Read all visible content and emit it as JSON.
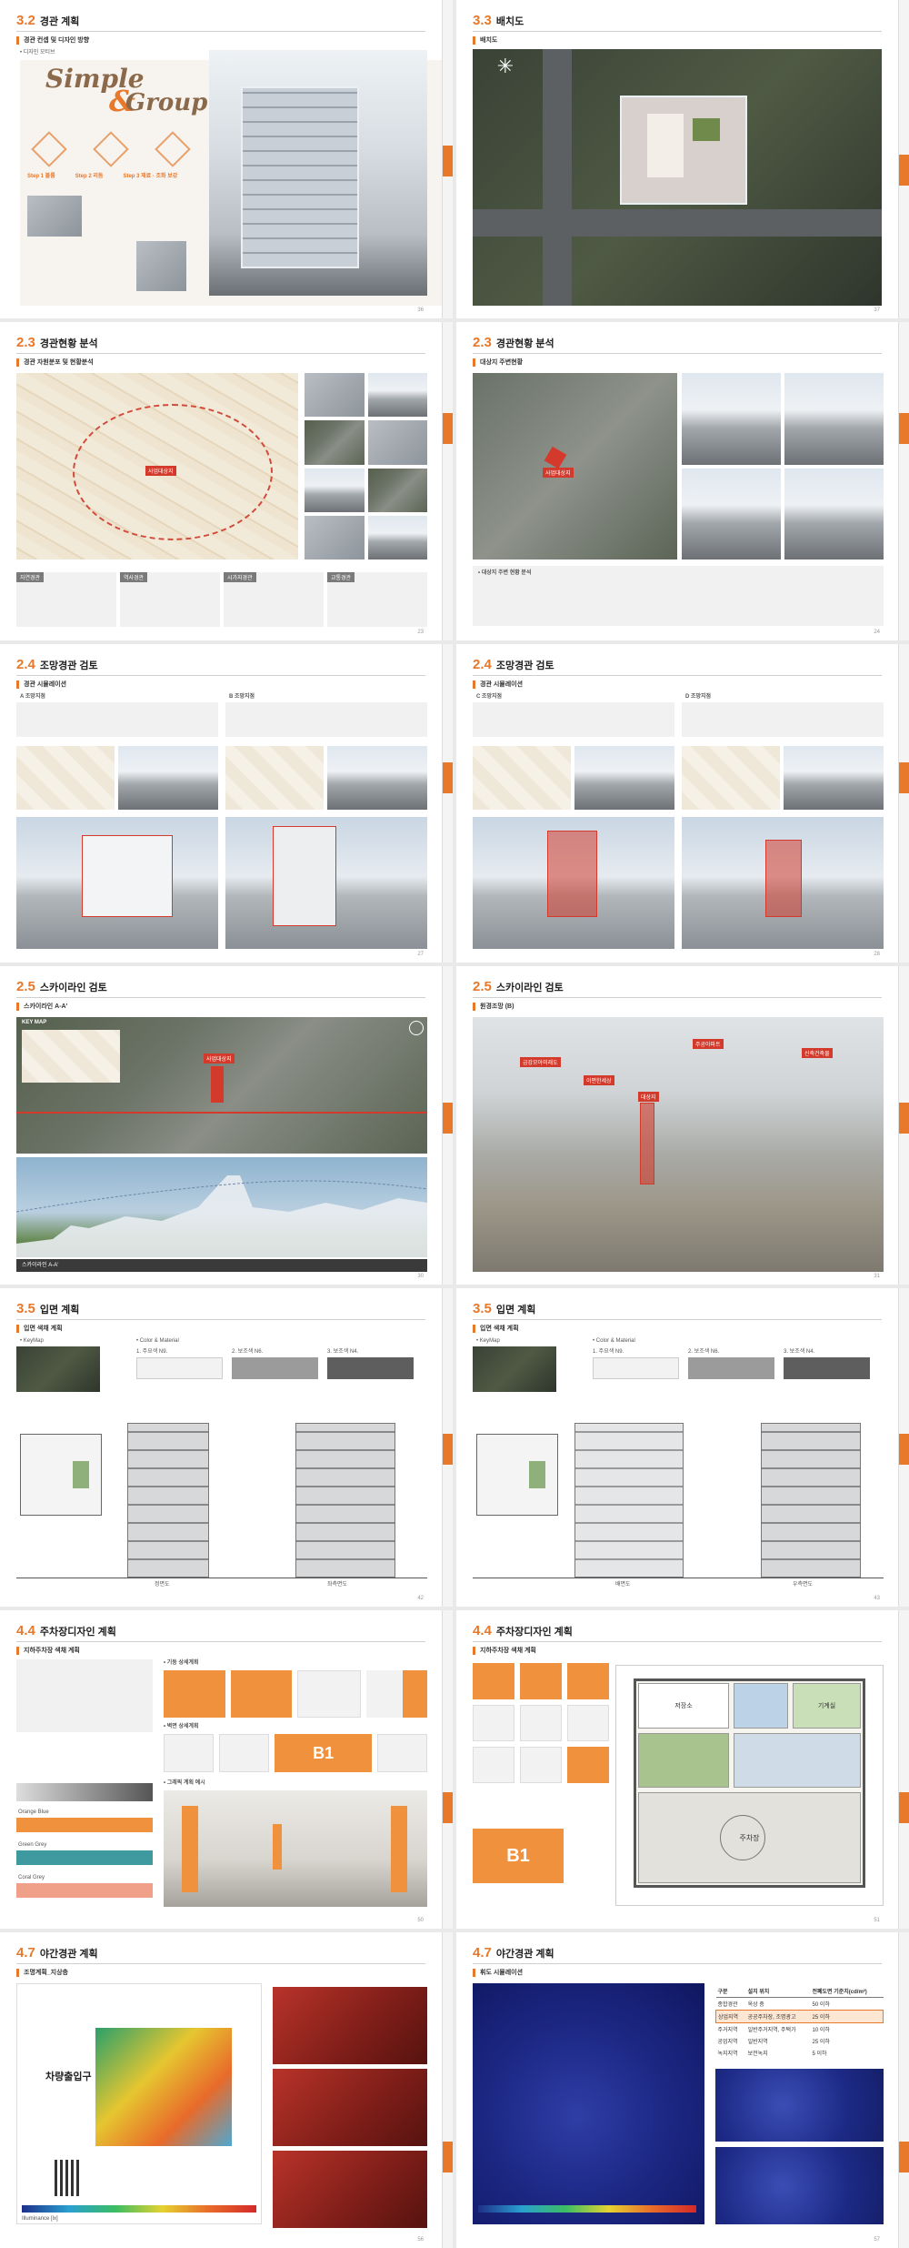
{
  "pages": [
    {
      "num": "3.2",
      "title": "경관 계획",
      "subtitle": "경관 컨셉 및 디자인 방향",
      "page_no": "36",
      "concept_1": "Simple",
      "concept_2": "&",
      "concept_3": "Group",
      "note": "• 디자인 모티브",
      "steps": [
        "Step 1 볼륨",
        "Step 2 리듬",
        "Step 3 재료 · 조화 보강"
      ]
    },
    {
      "num": "3.3",
      "title": "배치도",
      "subtitle": "배치도",
      "page_no": "37"
    },
    {
      "num": "2.3",
      "title": "경관현황 분석",
      "subtitle": "경관 자원분포 및 현황분석",
      "page_no": "23",
      "map_label": "사업대상지",
      "boxes": [
        "자연경관",
        "역사경관",
        "시가지경관",
        "교통경관"
      ]
    },
    {
      "num": "2.3",
      "title": "경관현황 분석",
      "subtitle": "대상지 주변현황",
      "page_no": "24",
      "map_label": "사업대상지",
      "caption": "• 대상지 주변 현황 분석"
    },
    {
      "num": "2.4",
      "title": "조망경관 검토",
      "subtitle": "경관 시뮬레이션",
      "page_no": "27",
      "views": [
        "A 조망지점",
        "B 조망지점"
      ],
      "labels": [
        "Key Map",
        "Before",
        "After"
      ]
    },
    {
      "num": "2.4",
      "title": "조망경관 검토",
      "subtitle": "경관 시뮬레이션",
      "page_no": "28",
      "views": [
        "C 조망지점",
        "D 조망지점"
      ],
      "labels": [
        "Key Map",
        "Before",
        "After"
      ]
    },
    {
      "num": "2.5",
      "title": "스카이라인 검토",
      "subtitle": "스카이라인 A-A'",
      "page_no": "30",
      "key_label": "KEY MAP",
      "site_label": "사업대상지",
      "bottom_note": "스카이라인 A-A'"
    },
    {
      "num": "2.5",
      "title": "스카이라인 검토",
      "subtitle": "원경조망 (B)",
      "page_no": "31",
      "tags": [
        "금강모아미래도",
        "이편한세상",
        "주공아파트",
        "대상지",
        "신축건축물"
      ]
    },
    {
      "num": "3.5",
      "title": "입면 계획",
      "subtitle": "입면 색채 계획",
      "page_no": "42",
      "key_label": "• KeyMap",
      "color_label": "• Color & Material",
      "swatches": [
        "1. 주요색 N9.",
        "2. 보조색 N6.",
        "3. 보조색 N4."
      ],
      "elevations": [
        "정면도",
        "좌측면도"
      ]
    },
    {
      "num": "3.5",
      "title": "입면 계획",
      "subtitle": "입면 색채 계획",
      "page_no": "43",
      "key_label": "• KeyMap",
      "color_label": "• Color & Material",
      "swatches": [
        "1. 주요색 N9.",
        "2. 보조색 N6.",
        "3. 보조색 N4."
      ],
      "elevations": [
        "배면도",
        "우측면도"
      ]
    },
    {
      "num": "4.4",
      "title": "주차장디자인 계획",
      "subtitle": "지하주차장 색채 계획",
      "page_no": "50",
      "sub_a": "• 기둥 상세계획",
      "sub_b": "• 벽면 상세계획",
      "sub_c": "• 그래픽 계획 예시",
      "b1": "B1",
      "color_rows": [
        "Orange Blue",
        "Green Grey",
        "Coral Grey"
      ]
    },
    {
      "num": "4.4",
      "title": "주차장디자인 계획",
      "subtitle": "지하주차장 색채 계획",
      "page_no": "51",
      "b1": "B1",
      "plan_labels": [
        "저장소",
        "기계실",
        "주차장"
      ]
    },
    {
      "num": "4.7",
      "title": "야간경관 계획",
      "subtitle": "조명계획_지상층",
      "page_no": "56",
      "entry_label": "차량출입구",
      "legend_unit": "Illuminance [lx]"
    },
    {
      "num": "4.7",
      "title": "야간경관 계획",
      "subtitle": "휘도 시뮬레이션",
      "page_no": "57",
      "table_headers": [
        "구분",
        "설치 위치",
        "전폐도면 기준치(cd/m²)"
      ],
      "table_rows": [
        [
          "종합경관",
          "옥상 층",
          "50 이하"
        ],
        [
          "상업지역",
          "공공주차장, 조명광고",
          "25 이하"
        ],
        [
          "주거지역",
          "일반주거지역, 주택가",
          "10 이하"
        ],
        [
          "공업지역",
          "일반지역",
          "25 이하"
        ],
        [
          "녹지지역",
          "보전녹지",
          "5 이하"
        ]
      ]
    }
  ],
  "colors": {
    "accent": "#e8782a",
    "teal": "#3f9aa0",
    "coral": "#f0a089"
  }
}
